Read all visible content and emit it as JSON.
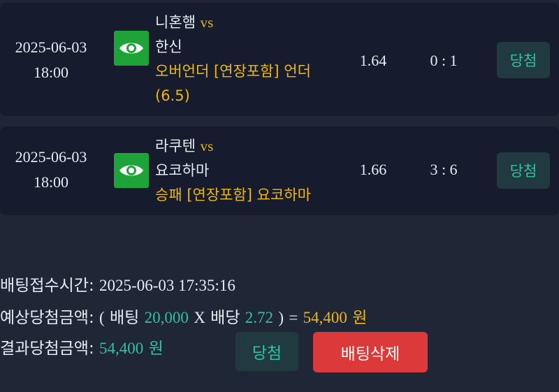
{
  "bets": [
    {
      "date": "2025-06-03",
      "time": "18:00",
      "home_team": "니혼햄",
      "vs": "vs",
      "away_team": "한신",
      "pick_line1": "오버언더 [연장포함] 언더",
      "pick_line2": "(6.5)",
      "odds": "1.64",
      "score": "0 : 1",
      "status": "당첨"
    },
    {
      "date": "2025-06-03",
      "time": "18:00",
      "home_team": "라쿠텐",
      "vs": "vs",
      "away_team": "요코하마",
      "pick_line1": "승패 [연장포함] 요코하마",
      "pick_line2": "",
      "odds": "1.66",
      "score": "3 : 6",
      "status": "당첨"
    }
  ],
  "summary": {
    "bet_time_label": "배팅접수시간:",
    "bet_time_value": "2025-06-03 17:35:16",
    "expected_label": "예상당첨금액:",
    "open_paren": "(",
    "stake_label": "배팅",
    "stake_value": "20,000",
    "times_sign": "X",
    "odds_label": "배당",
    "total_odds": "2.72",
    "close_paren": ")",
    "equals_sign": "=",
    "expected_amount": "54,400",
    "currency": "원",
    "result_label": "결과당첨금액:",
    "result_amount": "54,400",
    "result_currency": "원"
  },
  "actions": {
    "result_status": "당첨",
    "delete_label": "배팅삭제"
  },
  "colors": {
    "background": "#1f2636",
    "card": "#161c2d",
    "accent_green": "#2ec4a0",
    "accent_yellow": "#efb711",
    "eye_button": "#1ea338",
    "delete_button": "#dc3a3a"
  },
  "icons": {
    "detail": "eye-icon"
  }
}
